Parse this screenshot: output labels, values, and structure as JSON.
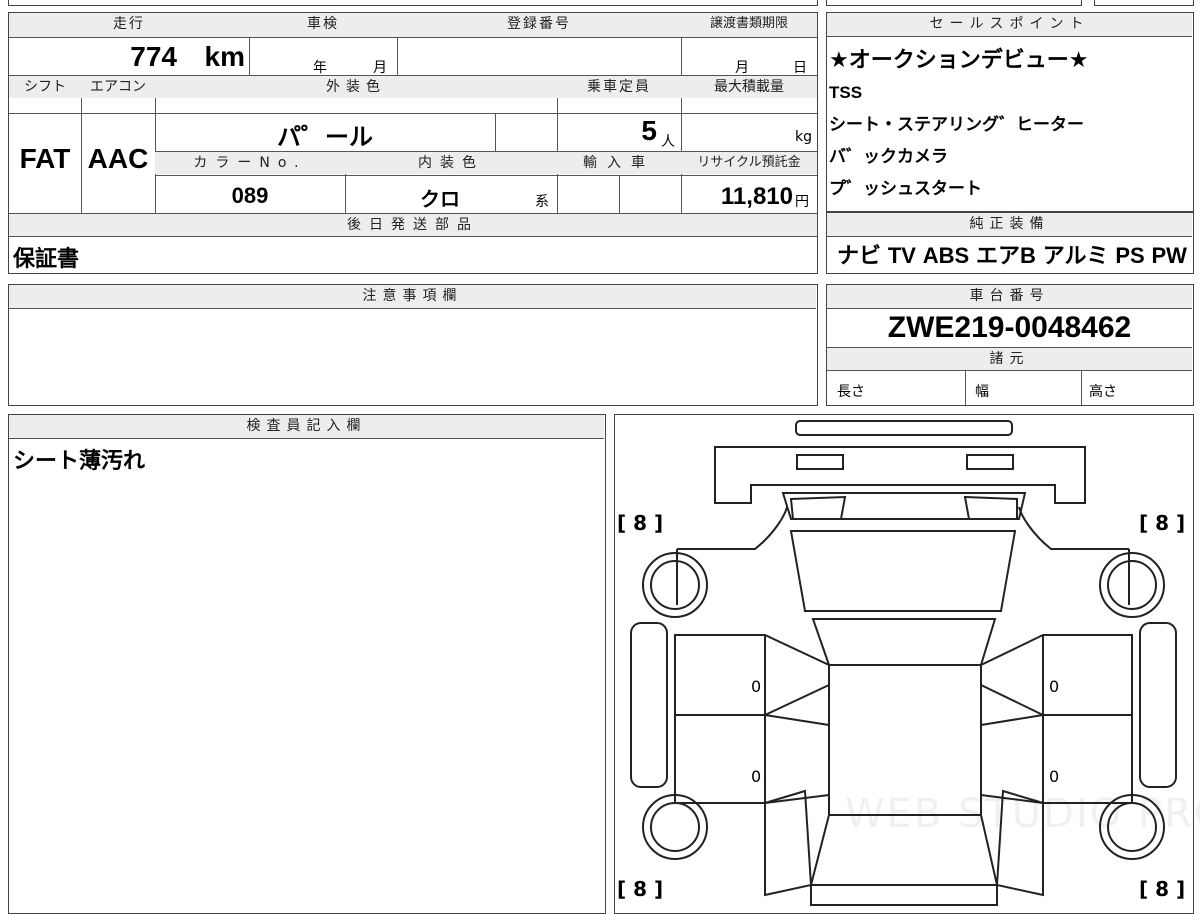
{
  "spec": {
    "mileage_header": "走行",
    "mileage_value": "774",
    "mileage_unit": "km",
    "inspection_header": "車検",
    "inspection_year_unit": "年",
    "inspection_month_unit": "月",
    "registration_header": "登録番号",
    "transfer_deadline_header": "譲渡書類期限",
    "transfer_month_unit": "月",
    "transfer_day_unit": "日",
    "shift_header": "シフト",
    "shift_value": "FAT",
    "ac_header": "エアコン",
    "ac_value": "AAC",
    "exterior_color_header": "外装色",
    "exterior_color_value": "パ゜ール",
    "capacity_header": "乗車定員",
    "capacity_value": "5",
    "capacity_unit": "人",
    "max_load_header": "最大積載量",
    "max_load_unit": "kg",
    "color_no_header": "カラーNo.",
    "color_no_value": "089",
    "interior_color_header": "内装色",
    "interior_color_value": "クロ",
    "interior_color_suffix": "系",
    "import_header": "輸入車",
    "recycle_header": "リサイクル預託金",
    "recycle_value": "11,810",
    "recycle_unit": "円",
    "later_parts_header": "後日発送部品",
    "later_parts_value": "保証書"
  },
  "sales_points": {
    "header": "セールスポイント",
    "items": [
      "★オークションデビュー★",
      "TSS",
      "シート・ステアリング゛ヒーター",
      "バ゛ックカメラ",
      "プ゛ッシュスタート"
    ]
  },
  "equipment": {
    "header": "純正装備",
    "items": [
      "ナビ",
      "TV",
      "ABS",
      "エアB",
      "アルミ",
      "PS",
      "PW"
    ]
  },
  "notes": {
    "header": "注意事項欄"
  },
  "chassis": {
    "header": "車台番号",
    "value": "ZWE219-0048462",
    "dimensions_header": "諸元",
    "length_label": "長さ",
    "width_label": "幅",
    "height_label": "高さ"
  },
  "inspector": {
    "header": "検査員記入欄",
    "comment": "シート薄汚れ"
  },
  "diagram": {
    "tire_fl": "[ 8 ]",
    "tire_fr": "[ 8 ]",
    "tire_rl": "[ 8 ]",
    "tire_rr": "[ 8 ]",
    "door_fl": "0",
    "door_fr": "0",
    "door_rl": "0",
    "door_rr": "0",
    "watermark": "WEB STUDIO PRO"
  }
}
